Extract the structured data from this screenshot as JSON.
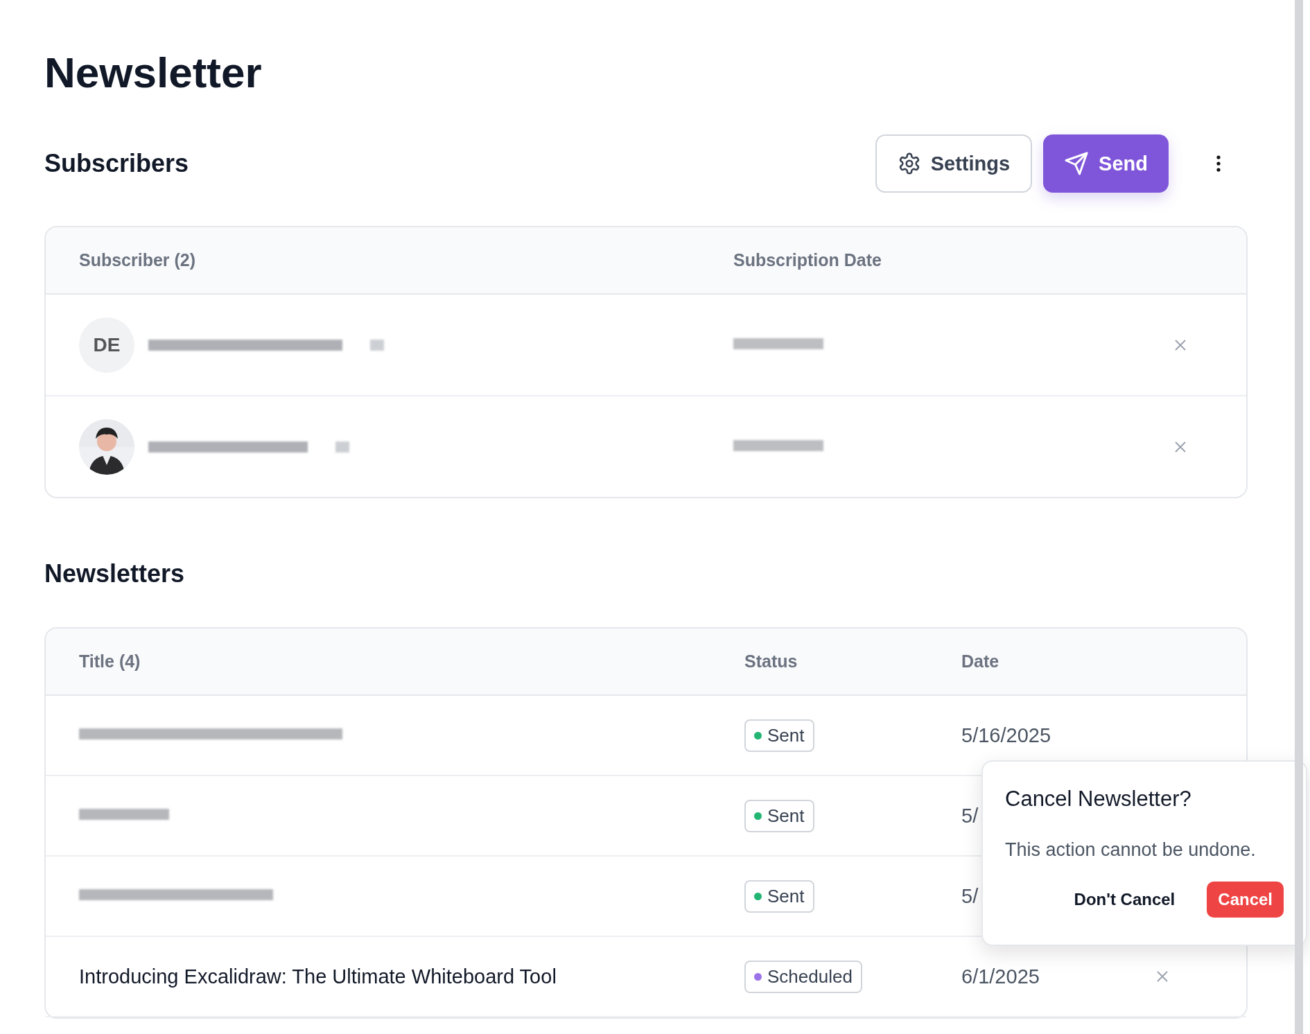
{
  "page": {
    "title": "Newsletter"
  },
  "subscribers": {
    "heading": "Subscribers",
    "actions": [
      {
        "kind": "settings",
        "label": "Settings"
      },
      {
        "kind": "send",
        "label": "Send"
      },
      {
        "kind": "more"
      }
    ],
    "columns": [
      "Subscriber (2)",
      "Subscription Date"
    ],
    "rows": [
      {
        "avatar": {
          "kind": "initials",
          "text": "DE"
        },
        "email": {
          "kind": "redacted"
        },
        "date": {
          "kind": "redacted"
        }
      },
      {
        "email": {
          "kind": "redacted"
        },
        "date": {
          "kind": "redacted"
        }
      }
    ]
  },
  "newsletters": {
    "heading": "Newsletters",
    "columns": [
      "Title (4)",
      "Status",
      "Date"
    ],
    "rows": [
      {
        "title": {
          "kind": "redacted"
        },
        "status": {
          "label": "Sent",
          "color": "#22b573"
        },
        "date": "5/16/2025",
        "removable": false
      },
      {
        "title": {
          "kind": "redacted"
        },
        "status": {
          "label": "Sent",
          "color": "#22b573"
        },
        "date": "5/"
      },
      {
        "title": {
          "kind": "redacted"
        },
        "status": {
          "label": "Sent",
          "color": "#22b573"
        },
        "date": "5/"
      },
      {
        "title": {
          "kind": "text",
          "text": "Introducing Excalidraw: The Ultimate Whiteboard Tool"
        },
        "status": {
          "label": "Scheduled",
          "color": "#9b72e8"
        },
        "date": "6/1/2025",
        "removable": true
      }
    ]
  },
  "popover": {
    "title": "Cancel Newsletter?",
    "message": "This action cannot be undone.",
    "buttons": [
      {
        "kind": "secondary",
        "label": "Don't Cancel"
      },
      {
        "kind": "danger",
        "label": "Cancel"
      }
    ]
  }
}
